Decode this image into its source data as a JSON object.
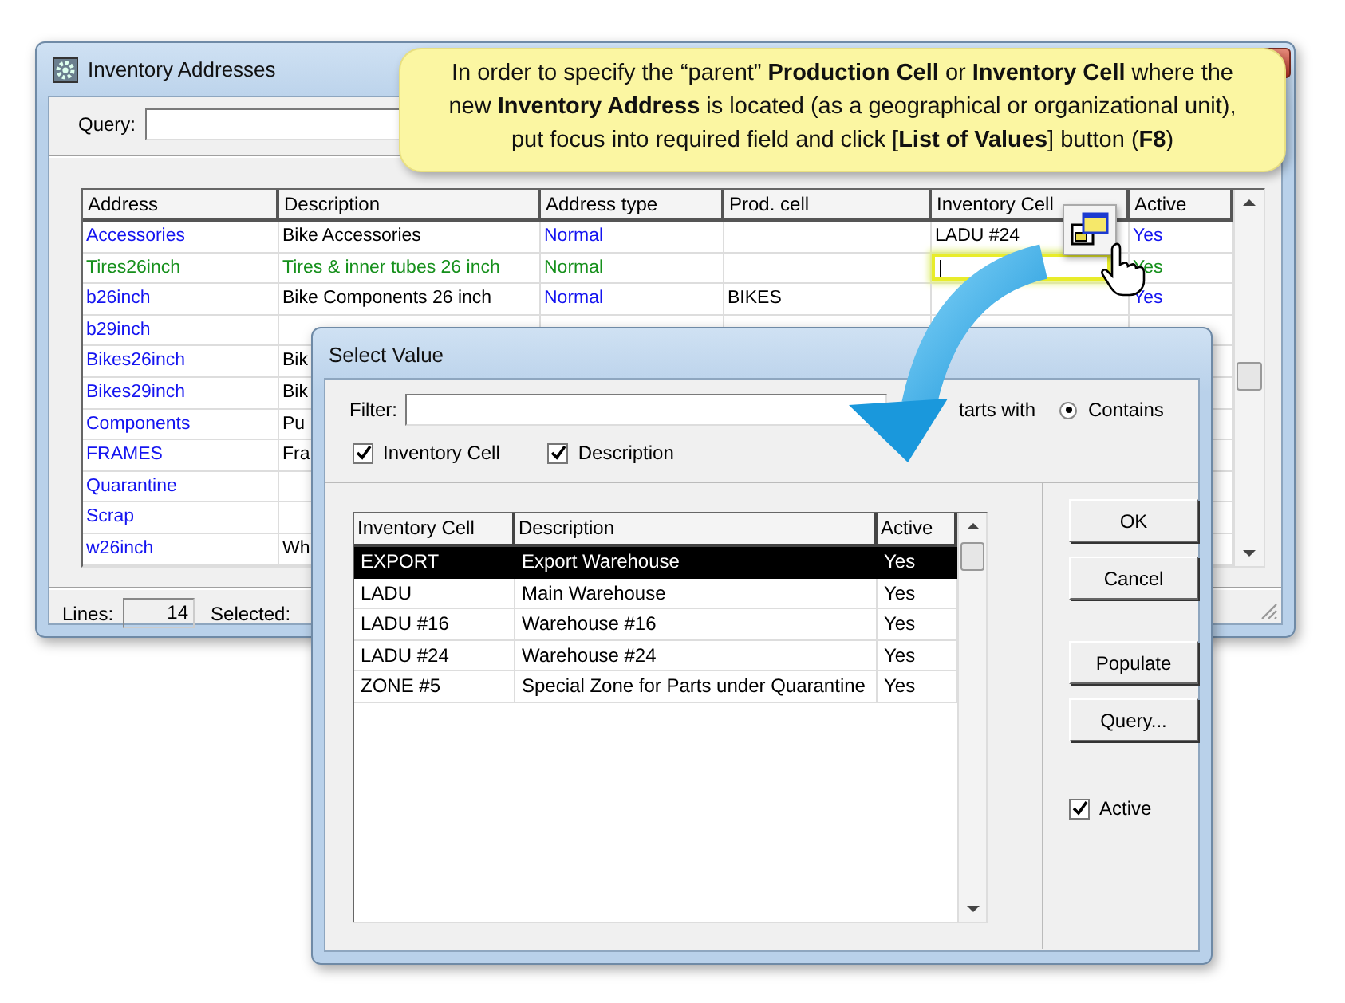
{
  "main_window": {
    "title": "Inventory Addresses",
    "query_label": "Query:",
    "table": {
      "columns": [
        "Address",
        "Description",
        "Address type",
        "Prod. cell",
        "Inventory Cell",
        "Active"
      ],
      "rows": [
        {
          "kind": "saved",
          "address": "Accessories",
          "description": "Bike Accessories",
          "address_type": "Normal",
          "inventory_cell": "LADU #24",
          "active": "Yes"
        },
        {
          "kind": "new",
          "address": "Tires26inch",
          "description": "Tires & inner tubes 26 inch",
          "address_type": "Normal",
          "active": "Yes"
        },
        {
          "kind": "saved",
          "address": "b26inch",
          "description": "Bike Components 26 inch",
          "address_type": "Normal",
          "prod_cell": "BIKES",
          "active": "Yes"
        },
        {
          "kind": "saved",
          "address": "b29inch"
        },
        {
          "kind": "saved",
          "address": "Bikes26inch",
          "description": "Bik"
        },
        {
          "kind": "saved",
          "address": "Bikes29inch",
          "description": "Bik"
        },
        {
          "kind": "saved",
          "address": "Components",
          "description": "Pu"
        },
        {
          "kind": "saved",
          "address": "FRAMES",
          "description": "Fra"
        },
        {
          "kind": "saved",
          "address": "Quarantine"
        },
        {
          "kind": "saved",
          "address": "Scrap"
        },
        {
          "kind": "saved",
          "address": "w26inch",
          "description": "Wh"
        }
      ]
    },
    "status_bar": {
      "lines_label": "Lines:",
      "lines_value": "14",
      "selected_label": "Selected:"
    }
  },
  "callout": {
    "text": "In order to specify the “parent” **Production Cell** or **Inventory Cell** where the new **Inventory Address** is located (as a geographical or organizational unit), put focus into required field and click [**List of Values**] button (**F8**)"
  },
  "dialog": {
    "title": "Select Value",
    "filter_label": "Filter:",
    "starts_with_label": "tarts with",
    "contains_option": {
      "label": "Contains",
      "selected": true
    },
    "search_in": [
      {
        "label": "Inventory Cell",
        "checked": true
      },
      {
        "label": "Description",
        "checked": true
      }
    ],
    "list": {
      "columns": [
        "Inventory Cell",
        "Description",
        "Active"
      ],
      "rows": [
        {
          "cell": "EXPORT",
          "description": "Export Warehouse",
          "active": "Yes",
          "selected": true
        },
        {
          "cell": "LADU",
          "description": "Main Warehouse",
          "active": "Yes",
          "selected": false
        },
        {
          "cell": "LADU #16",
          "description": "Warehouse #16",
          "active": "Yes",
          "selected": false
        },
        {
          "cell": "LADU #24",
          "description": "Warehouse #24",
          "active": "Yes",
          "selected": false
        },
        {
          "cell": "ZONE #5",
          "description": "Special Zone for Parts under Quarantine",
          "active": "Yes",
          "selected": false
        }
      ]
    },
    "buttons": [
      {
        "label": "OK",
        "kind": "ok"
      },
      {
        "label": "Cancel",
        "kind": "cancel"
      },
      {
        "label": "Populate",
        "kind": "populate"
      },
      {
        "label": "Query...",
        "kind": "query"
      }
    ],
    "active_filter": {
      "label": "Active",
      "checked": true
    }
  }
}
